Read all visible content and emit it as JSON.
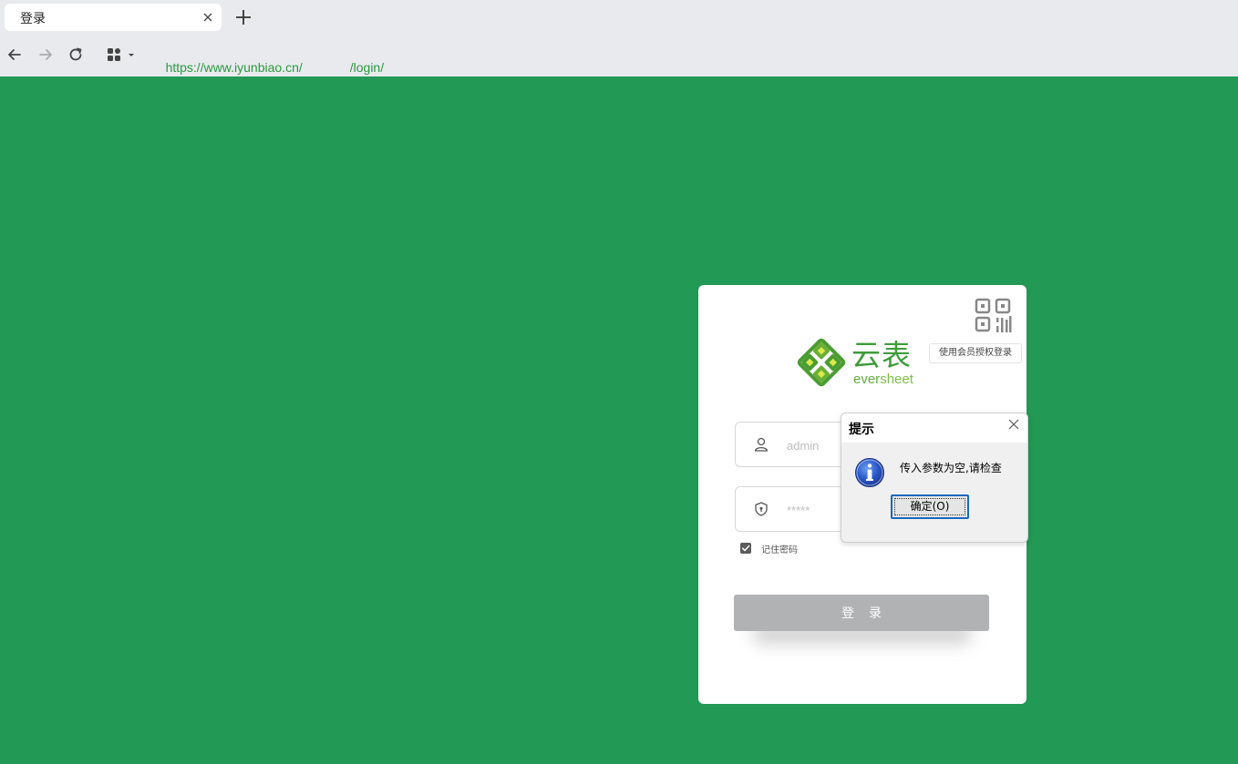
{
  "browser": {
    "tab_title": "登录",
    "url_host": "https://www.iyunbiao.cn/",
    "url_path": "/login/"
  },
  "card": {
    "qr_tip": "使用会员授权登录",
    "logo_cn": "云表",
    "logo_en_a": "ever",
    "logo_en_b": "sheet",
    "username_placeholder": "admin",
    "password_placeholder": "*****",
    "remember_label": "记住密码",
    "remember_checked": true,
    "login_label": "登录"
  },
  "dialog": {
    "title": "提示",
    "message": "传入参数为空,请检查",
    "ok_label": "确定(O)"
  },
  "colors": {
    "background": "#229955",
    "accent_green": "#3e9c3a",
    "button_disabled": "#b1b2b4"
  }
}
